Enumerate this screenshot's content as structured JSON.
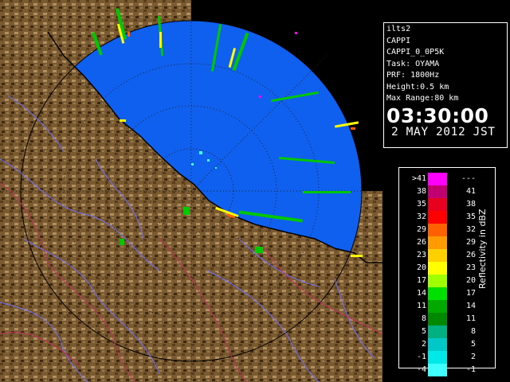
{
  "info": {
    "lines": [
      "ilts2",
      "CAPPI",
      "CAPPI_0_0P5K",
      "Task: OYAMA",
      "PRF: 1800Hz",
      "Height:0.5 km",
      "Max Range:80 km"
    ],
    "time": "03:30:00",
    "date": "2 MAY 2012 JST"
  },
  "legend": {
    "unit": "Reflectivity in dBZ",
    "left_labels": [
      ">41",
      "38",
      "35",
      "32",
      "29",
      "26",
      "23",
      "20",
      "17",
      "14",
      "11",
      "8",
      "5",
      "2",
      "-1",
      "-4"
    ],
    "right_labels": [
      "---",
      "41",
      "38",
      "35",
      "32",
      "29",
      "26",
      "23",
      "20",
      "17",
      "14",
      "11",
      "8",
      "5",
      "2",
      "-1"
    ],
    "colors": [
      "#ff00ff",
      "#c00070",
      "#e80020",
      "#ff0000",
      "#ff6000",
      "#ff9a00",
      "#ffd000",
      "#ffff00",
      "#a0ff00",
      "#00e000",
      "#00a800",
      "#008800",
      "#00b080",
      "#00c8c8",
      "#00e8e8",
      "#40ffff"
    ]
  },
  "map": {
    "sea_color": "#1060f0",
    "land_color": "#7a5a30",
    "river_color": "#7070ff",
    "boundary_color": "#c03060"
  }
}
